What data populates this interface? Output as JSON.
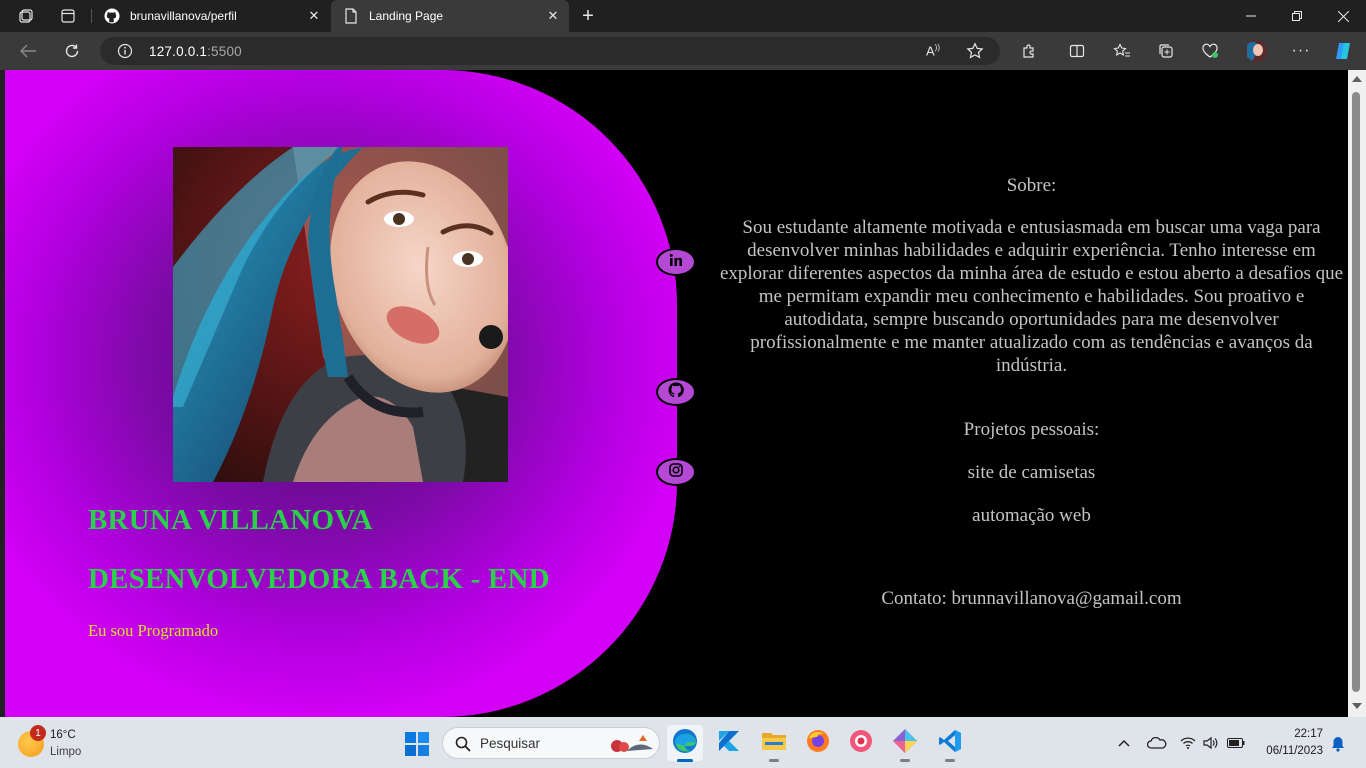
{
  "browser": {
    "tabs": [
      {
        "title": "brunavillanova/perfil",
        "favicon": "github-icon"
      },
      {
        "title": "Landing Page",
        "favicon": "page-icon",
        "active": true
      }
    ],
    "address": {
      "host": "127.0.0.1",
      "port": ":5500"
    }
  },
  "page": {
    "name": "BRUNA VILLANOVA",
    "role": "DESENVOLVEDORA BACK - END",
    "tagline": "Eu sou Programado",
    "about_title": "Sobre:",
    "about_text": "Sou estudante altamente motivada e entusiasmada em buscar uma vaga para desenvolver minhas habilidades e adquirir experiência. Tenho interesse em explorar diferentes aspectos da minha área de estudo e estou aberto a desafios que me permitam expandir meu conhecimento e habilidades. Sou proativo e autodidata, sempre buscando oportunidades para me desenvolver profissionalmente e me manter atualizado com as tendências e avanços da indústria.",
    "projects_title": "Projetos pessoais:",
    "projects": [
      "site de camisetas",
      "automação web"
    ],
    "contact": "Contato: brunnavillanova@gamail.com",
    "social_icons": [
      "linkedin-icon",
      "github-icon",
      "instagram-icon"
    ],
    "colors": {
      "name_green": "#2ad24a",
      "tagline_yellow": "#d8e028",
      "hero_purple": "#b200e0",
      "social_button": "#b549d6"
    }
  },
  "taskbar": {
    "weather": {
      "temp": "16°C",
      "condition": "Limpo",
      "badge": "1"
    },
    "search_label": "Pesquisar",
    "apps": [
      "edge-icon",
      "kotlin-icon",
      "file-explorer-icon",
      "firefox-icon",
      "screen-recorder-icon",
      "git-client-icon",
      "vscode-icon"
    ],
    "clock": {
      "time": "22:17",
      "date": "06/11/2023"
    }
  }
}
